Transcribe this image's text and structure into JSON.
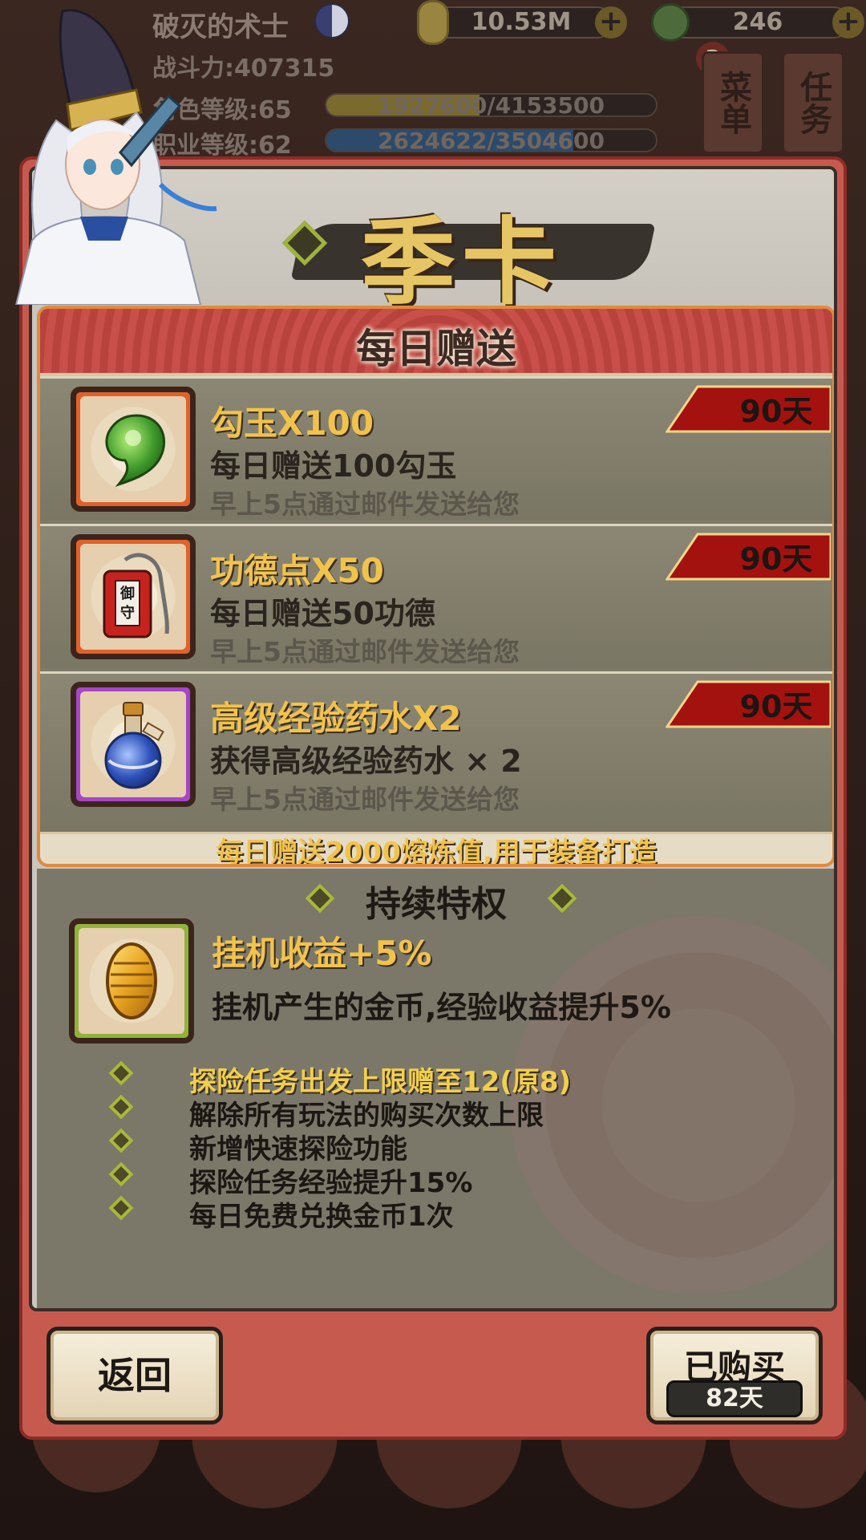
{
  "hud": {
    "player_name": "破灭的术士",
    "gold": "10.53M",
    "jade": "246",
    "combat_power": "战斗力:407315",
    "role_level": "角色等级:65",
    "role_exp": "1927600/4153500",
    "role_exp_fraction": 0.464,
    "job_level": "职业等级:62",
    "job_exp": "2624622/3504600",
    "job_exp_fraction": 0.749,
    "menu_label": "菜单",
    "task_label": "任务",
    "task_badge": "3"
  },
  "panel": {
    "title": "季卡",
    "daily_header": "每日赠送",
    "daily_items": [
      {
        "title": "勾玉X100",
        "desc": "每日赠送100勾玉",
        "note": "早上5点通过邮件发送给您",
        "days": "90天",
        "icon": "magatama-icon",
        "frame": "orange"
      },
      {
        "title": "功德点X50",
        "desc": "每日赠送50功德",
        "note": "早上5点通过邮件发送给您",
        "days": "90天",
        "icon": "omamori-charm-icon",
        "frame": "orange"
      },
      {
        "title": "高级经验药水X2",
        "desc": "获得高级经验药水 × 2",
        "note": "早上5点通过邮件发送给您",
        "days": "90天",
        "icon": "potion-flask-icon",
        "frame": "purple"
      }
    ],
    "daily_footer": "每日赠送2000熔炼值,用于装备打造",
    "privilege_header": "持续特权",
    "privilege_item": {
      "title": "挂机收益+5%",
      "desc": "挂机产生的金币,经验收益提升5%",
      "icon": "gold-koban-icon"
    },
    "privilege_list": [
      "探险任务出发上限赠至12(原8)",
      "解除所有玩法的购买次数上限",
      "新增快速探险功能",
      "探险任务经验提升15%",
      "每日免费兑换金币1次"
    ]
  },
  "buttons": {
    "back": "返回",
    "bought": "已购买",
    "remaining": "82天"
  },
  "colors": {
    "gold_text": "#f0c34b",
    "panel_red": "#c75a4f",
    "daily_border": "#e08a3f",
    "days_ribbon": "#a3120f"
  }
}
